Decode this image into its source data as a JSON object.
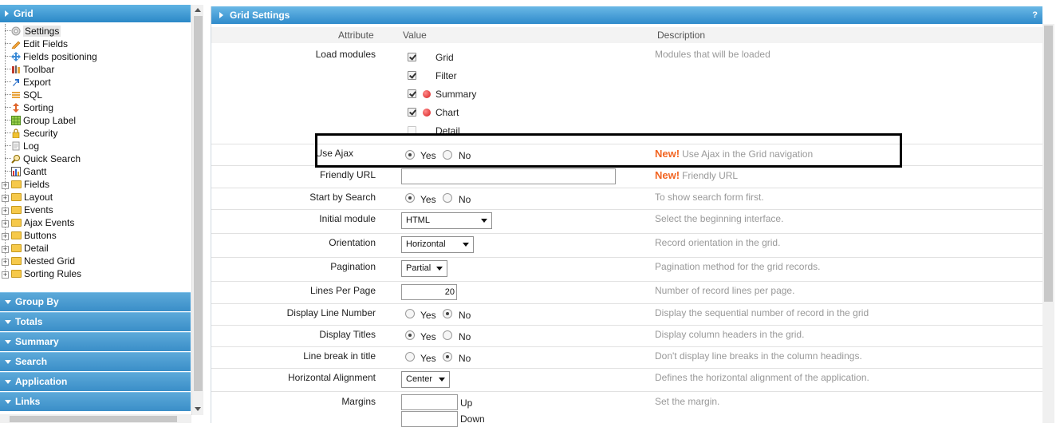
{
  "sidebar": {
    "header": "Grid",
    "tree": [
      {
        "label": "Settings",
        "icon": "settings-gear-icon",
        "selected": true
      },
      {
        "label": "Edit Fields",
        "icon": "pencil-icon"
      },
      {
        "label": "Fields positioning",
        "icon": "move-arrows-icon"
      },
      {
        "label": "Toolbar",
        "icon": "toolbar-tools-icon"
      },
      {
        "label": "Export",
        "icon": "export-arrow-icon"
      },
      {
        "label": "SQL",
        "icon": "sql-database-icon"
      },
      {
        "label": "Sorting",
        "icon": "sort-arrows-icon"
      },
      {
        "label": "Group Label",
        "icon": "grid-table-icon"
      },
      {
        "label": "Security",
        "icon": "lock-icon"
      },
      {
        "label": "Log",
        "icon": "log-document-icon"
      },
      {
        "label": "Quick Search",
        "icon": "magnifier-icon"
      },
      {
        "label": "Gantt",
        "icon": "gantt-chart-icon"
      },
      {
        "label": "Fields",
        "icon": "folder-icon",
        "expandable": true
      },
      {
        "label": "Layout",
        "icon": "folder-icon",
        "expandable": true
      },
      {
        "label": "Events",
        "icon": "folder-icon",
        "expandable": true
      },
      {
        "label": "Ajax Events",
        "icon": "folder-icon",
        "expandable": true
      },
      {
        "label": "Buttons",
        "icon": "folder-icon",
        "expandable": true
      },
      {
        "label": "Detail",
        "icon": "folder-icon",
        "expandable": true
      },
      {
        "label": "Nested Grid",
        "icon": "folder-icon",
        "expandable": true
      },
      {
        "label": "Sorting Rules",
        "icon": "folder-icon",
        "expandable": true
      }
    ],
    "sections": [
      "Group By",
      "Totals",
      "Summary",
      "Search",
      "Application",
      "Links"
    ]
  },
  "main": {
    "title": "Grid Settings",
    "help": "?",
    "columns": {
      "attribute": "Attribute",
      "value": "Value",
      "description": "Description"
    },
    "new_badge": "New!",
    "load_modules": {
      "label": "Load modules",
      "description": "Modules that will be loaded",
      "modules": [
        {
          "name": "Grid",
          "checked": true,
          "dot": false
        },
        {
          "name": "Filter",
          "checked": true,
          "dot": false
        },
        {
          "name": "Summary",
          "checked": true,
          "dot": true
        },
        {
          "name": "Chart",
          "checked": true,
          "dot": true
        },
        {
          "name": "Detail",
          "checked": false,
          "dot": false
        }
      ]
    },
    "use_ajax": {
      "label": "Use Ajax",
      "yes": "Yes",
      "no": "No",
      "value": "Yes",
      "description": "Use Ajax in the Grid navigation"
    },
    "friendly_url": {
      "label": "Friendly URL",
      "value": "",
      "description": "Friendly URL"
    },
    "start_by_search": {
      "label": "Start by Search",
      "yes": "Yes",
      "no": "No",
      "value": "Yes",
      "description": "To show search form first."
    },
    "initial_module": {
      "label": "Initial module",
      "value": "HTML",
      "description": "Select the beginning interface."
    },
    "orientation": {
      "label": "Orientation",
      "value": "Horizontal",
      "description": "Record orientation in the grid."
    },
    "pagination": {
      "label": "Pagination",
      "value": "Partial",
      "description": "Pagination method for the grid records."
    },
    "lines_per_page": {
      "label": "Lines Per Page",
      "value": "20",
      "description": "Number of record lines per page."
    },
    "display_line_number": {
      "label": "Display Line Number",
      "yes": "Yes",
      "no": "No",
      "value": "No",
      "description": "Display the sequential number of record in the grid"
    },
    "display_titles": {
      "label": "Display Titles",
      "yes": "Yes",
      "no": "No",
      "value": "Yes",
      "description": "Display column headers in the grid."
    },
    "line_break_title": {
      "label": "Line break in title",
      "yes": "Yes",
      "no": "No",
      "value": "No",
      "description": "Don't display line breaks in the column headings."
    },
    "horizontal_alignment": {
      "label": "Horizontal Alignment",
      "value": "Center",
      "description": "Defines the horizontal alignment of the application."
    },
    "margins": {
      "label": "Margins",
      "up": "Up",
      "down": "Down",
      "description": "Set the margin."
    }
  }
}
